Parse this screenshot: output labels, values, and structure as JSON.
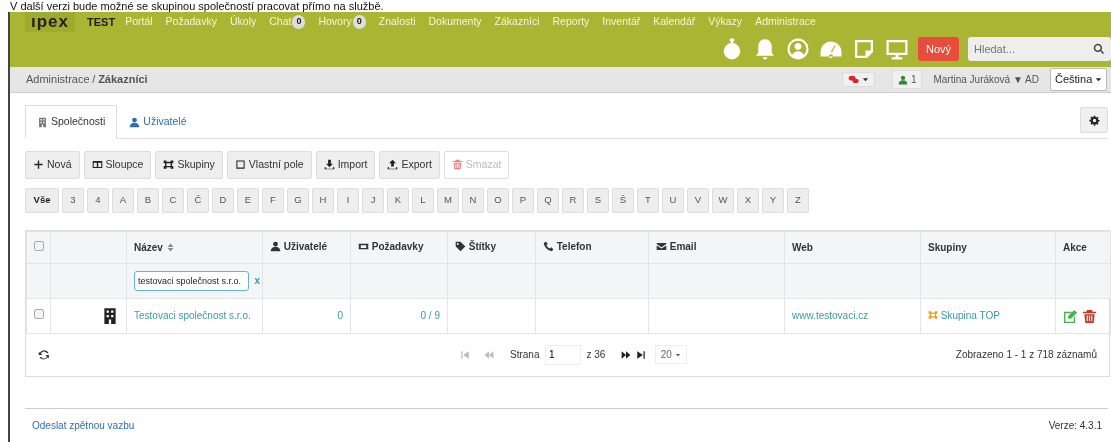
{
  "caption": "V další verzi bude možné se skupinou společností pracovat přímo na službě.",
  "navbar": {
    "logo": "ıpex",
    "environment": "TEST",
    "menu": [
      {
        "label": "Portál"
      },
      {
        "label": "Požadavky"
      },
      {
        "label": "Úkoly"
      },
      {
        "label": "Chat",
        "badge": "0"
      },
      {
        "label": "Hovory",
        "badge": "0"
      },
      {
        "label": "Znalosti"
      },
      {
        "label": "Dokumenty"
      },
      {
        "label": "Zákazníci"
      },
      {
        "label": "Reporty"
      },
      {
        "label": "Inventář"
      },
      {
        "label": "Kalendář"
      },
      {
        "label": "Výkazy"
      },
      {
        "label": "Administrace"
      }
    ],
    "new_button": "Nový",
    "search": {
      "placeholder": "Hledat..."
    }
  },
  "breadcrumb": {
    "parent": "Administrace",
    "separator": "/",
    "current": "Zákazníci",
    "online_users": "1",
    "user": "Martina Juráková ▼ AD",
    "language": "Čeština"
  },
  "tabs": [
    {
      "label": "Společnosti",
      "kind": "building",
      "selected": true
    },
    {
      "label": "Uživatelé",
      "kind": "user",
      "selected": false
    }
  ],
  "toolbar": [
    {
      "label": "Nová",
      "kind": "plus",
      "disabled": false
    },
    {
      "label": "Sloupce",
      "kind": "columns",
      "disabled": false
    },
    {
      "label": "Skupiny",
      "kind": "group",
      "disabled": false
    },
    {
      "label": "Vlastní pole",
      "kind": "square",
      "disabled": false
    },
    {
      "label": "Import",
      "kind": "import",
      "disabled": false
    },
    {
      "label": "Export",
      "kind": "export",
      "disabled": false
    },
    {
      "label": "Smazat",
      "kind": "trash",
      "disabled": true
    }
  ],
  "letters": [
    {
      "label": "Vše",
      "selected": true
    },
    {
      "label": "3",
      "selected": false
    },
    {
      "label": "4",
      "selected": false
    },
    {
      "label": "A",
      "selected": false
    },
    {
      "label": "B",
      "selected": false
    },
    {
      "label": "C",
      "selected": false
    },
    {
      "label": "Č",
      "selected": false
    },
    {
      "label": "D",
      "selected": false
    },
    {
      "label": "E",
      "selected": false
    },
    {
      "label": "F",
      "selected": false
    },
    {
      "label": "G",
      "selected": false
    },
    {
      "label": "H",
      "selected": false
    },
    {
      "label": "I",
      "selected": false
    },
    {
      "label": "J",
      "selected": false
    },
    {
      "label": "K",
      "selected": false
    },
    {
      "label": "L",
      "selected": false
    },
    {
      "label": "M",
      "selected": false
    },
    {
      "label": "N",
      "selected": false
    },
    {
      "label": "O",
      "selected": false
    },
    {
      "label": "P",
      "selected": false
    },
    {
      "label": "Q",
      "selected": false
    },
    {
      "label": "R",
      "selected": false
    },
    {
      "label": "S",
      "selected": false
    },
    {
      "label": "Š",
      "selected": false
    },
    {
      "label": "T",
      "selected": false
    },
    {
      "label": "U",
      "selected": false
    },
    {
      "label": "V",
      "selected": false
    },
    {
      "label": "W",
      "selected": false
    },
    {
      "label": "X",
      "selected": false
    },
    {
      "label": "Y",
      "selected": false
    },
    {
      "label": "Z",
      "selected": false
    }
  ],
  "table": {
    "select_all_checked": false,
    "columns": [
      {
        "kind": "check"
      },
      {
        "kind": "blank"
      },
      {
        "label": "Název",
        "kind": "sort"
      },
      {
        "label": "Uživatelé",
        "kind": "user"
      },
      {
        "label": "Požadavky",
        "kind": "ticket"
      },
      {
        "label": "Štítky",
        "kind": "tag"
      },
      {
        "label": "Telefon",
        "kind": "phone"
      },
      {
        "label": "Email",
        "kind": "mail"
      },
      {
        "label": "Web",
        "kind": "plain"
      },
      {
        "label": "Skupiny",
        "kind": "plain"
      },
      {
        "label": "Akce",
        "kind": "plain"
      }
    ],
    "filter": {
      "value": "testovaci společnost s.r.o.",
      "clear": "x"
    },
    "rows": [
      {
        "checked": false,
        "name": "Testovaci společnost s.r.o.",
        "users": "0",
        "requests": "0 / 9",
        "web": "www.testovaci.cz",
        "group": "Skupina TOP"
      }
    ],
    "pager": {
      "page_label": "Strana",
      "page": "1",
      "of": "z 36",
      "page_size": "20",
      "summary": "Zobrazeno 1 - 1 z 718 záznamů"
    }
  },
  "footer": {
    "feedback": "Odeslat zpětnou vazbu",
    "version": "Verze: 4.3.1"
  }
}
